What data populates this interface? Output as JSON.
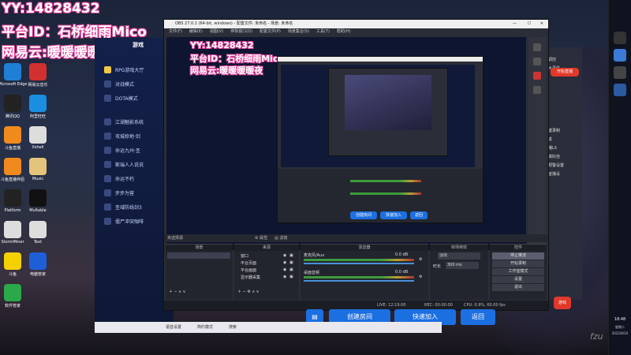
{
  "overlay": {
    "yy": "YY:14828432",
    "platform": "平台ID：石桥细雨Mico",
    "netease": "网易云:暖暖暖暖夜"
  },
  "desktop_icons": [
    {
      "label": "Microsoft Edge",
      "color": "#1f7fd6"
    },
    {
      "label": "网易云音乐",
      "color": "#d23030"
    },
    {
      "label": "腾讯QQ",
      "color": "#222"
    },
    {
      "label": "阿里旺旺",
      "color": "#1a8fe0"
    },
    {
      "label": "斗鱼直播",
      "color": "#f08a1c"
    },
    {
      "label": "Xshell",
      "color": "#ddd"
    },
    {
      "label": "斗鱼直播伴侣",
      "color": "#f08a1c"
    },
    {
      "label": "Music",
      "color": "#e4c37a"
    },
    {
      "label": "Platform",
      "color": "#222"
    },
    {
      "label": "Multable",
      "color": "#111"
    },
    {
      "label": "StormMiner",
      "color": "#ddd"
    },
    {
      "label": "Text",
      "color": "#ddd"
    },
    {
      "label": "斗鱼",
      "color": "#f5d000"
    },
    {
      "label": "电脑管家",
      "color": "#1e5fd8"
    },
    {
      "label": "软件管家",
      "color": "#2aa84a"
    }
  ],
  "game": {
    "tab": "游戏",
    "menu": [
      "RPG游戏大厅",
      "对战模式",
      "DOTA模式",
      "江湖魅影系统",
      "攻城掠地·剑",
      "命运九州·圣",
      "斯瑞人人说说",
      "命运不朽",
      "步步为营",
      "圣域防线剑3",
      "僵尸冲突咖啡"
    ]
  },
  "obs": {
    "title": "OBS 27.0.1 (64-bit, windows) - 配置文件: 未命名 - 场景: 未命名",
    "menu": [
      "文件(F)",
      "编辑(E)",
      "视图(V)",
      "停靠窗口(D)",
      "配置文件(P)",
      "场景集合(S)",
      "工具(T)",
      "帮助(H)"
    ],
    "inner_overlay": {
      "yy": "YY:14828432",
      "platform": "平台ID：石桥细雨Mico",
      "netease": "网易云:暖暖暖暖夜"
    },
    "no_source": "未选择源",
    "props_btn": "属性",
    "filters_btn": "滤镜",
    "docks": {
      "scenes": "场景",
      "sources": "来源",
      "mixer": "混音器",
      "transitions": "转场特效",
      "controls": "控件"
    },
    "sources": [
      "窗口",
      "平台页面",
      "平台画面",
      "显示器采集"
    ],
    "mixer_tracks": [
      {
        "name": "麦克风/Aux",
        "level": "0.0 dB"
      },
      {
        "name": "桌面音频",
        "level": "0.0 dB"
      }
    ],
    "transition": "淡出",
    "duration_label": "时长",
    "duration": "300 ms",
    "controls": [
      "停止推流",
      "开始录制",
      "工作室模式",
      "设置",
      "退出"
    ],
    "status": {
      "live": "LIVE: 12:19:00",
      "rec": "REC: 00:00:00",
      "cpu": "CPU: 0.9%, 60.00 fps"
    }
  },
  "buttons": {
    "create_room": "创建房间",
    "quick_join": "快速加入",
    "back": "返回"
  },
  "bottom_bar": [
    "语音设置",
    "简约模式",
    "搜索"
  ],
  "right_panel": {
    "items": [
      "语调控",
      "送大事件",
      "一键录制",
      "放进",
      "直播LS",
      "我做好自",
      "的预警设置",
      "宇宙播设"
    ],
    "primary": "开始直播",
    "secondary": "游戏"
  },
  "clock": {
    "time": "18:48",
    "weekday": "星期二",
    "date": "2022/8/20"
  },
  "corner_text": "fzu"
}
